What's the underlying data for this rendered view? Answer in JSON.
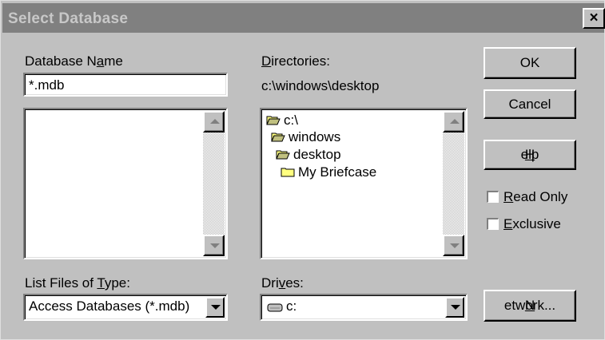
{
  "dialog": {
    "title": "Select Database",
    "close_glyph": "×"
  },
  "database_name": {
    "label_pre": "Database N",
    "label_key": "a",
    "label_post": "me",
    "value": "*.mdb"
  },
  "directories": {
    "label_key": "D",
    "label_post": "irectories:",
    "current_path": "c:\\windows\\desktop",
    "tree": [
      {
        "label": "c:\\",
        "icon": "open-folder-icon"
      },
      {
        "label": "windows",
        "icon": "open-folder-icon"
      },
      {
        "label": "desktop",
        "icon": "open-folder-icon"
      },
      {
        "label": "My Briefcase",
        "icon": "folder-icon"
      }
    ]
  },
  "file_type": {
    "label_pre": "List Files of ",
    "label_key": "T",
    "label_post": "ype:",
    "selected": "Access Databases (*.mdb)"
  },
  "drives": {
    "label_pre": "Dri",
    "label_key": "v",
    "label_post": "es:",
    "selected": "c:",
    "icon": "drive-icon"
  },
  "buttons": {
    "ok": "OK",
    "cancel": "Cancel",
    "help_key": "H",
    "help_post": "elp",
    "network_key": "N",
    "network_post": "etwork..."
  },
  "options": {
    "read_only_key": "R",
    "read_only_post": "ead Only",
    "read_only_checked": false,
    "exclusive_key": "E",
    "exclusive_post": "xclusive",
    "exclusive_checked": false
  },
  "colors": {
    "face": "#c0c0c0",
    "title_inactive": "#808080",
    "title_text": "#c8c8c8",
    "folder": "#ffff80"
  }
}
